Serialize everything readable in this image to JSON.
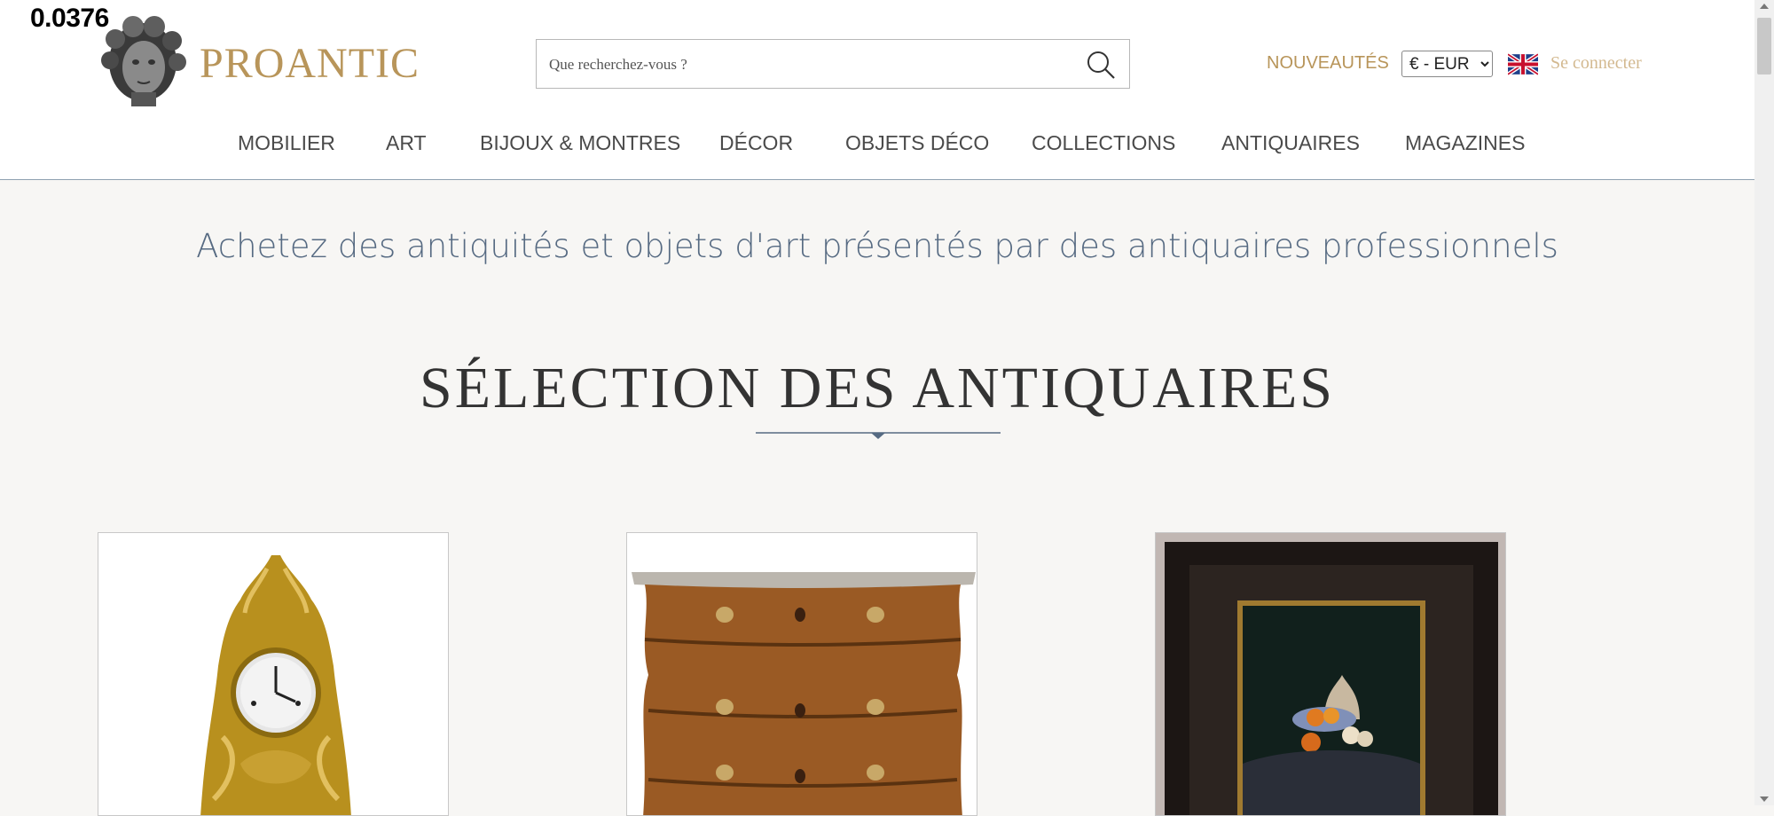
{
  "overlay": {
    "value": "0.0376"
  },
  "header": {
    "logo_text": "PROANTIC",
    "search_placeholder": "Que recherchez-vous ?",
    "nouveautes": "NOUVEAUTÉS",
    "currency_selected": "€ - EUR",
    "login": "Se connecter"
  },
  "nav": {
    "items": [
      "MOBILIER",
      "ART",
      "BIJOUX & MONTRES",
      "DÉCOR",
      "OBJETS DÉCO",
      "COLLECTIONS",
      "ANTIQUAIRES",
      "MAGAZINES"
    ]
  },
  "main": {
    "tagline": "Achetez des antiquités et objets d'art présentés par des antiquaires professionnels",
    "section_title": "SÉLECTION DES ANTIQUAIRES"
  },
  "colors": {
    "brand_gold": "#b8955a",
    "nav_text": "#4a4a4a",
    "tagline_blue": "#566a82",
    "page_bg": "#f7f6f4"
  },
  "icons": [
    "logo-bust-icon",
    "search-icon",
    "uk-flag-icon",
    "divider-diamond-icon"
  ]
}
